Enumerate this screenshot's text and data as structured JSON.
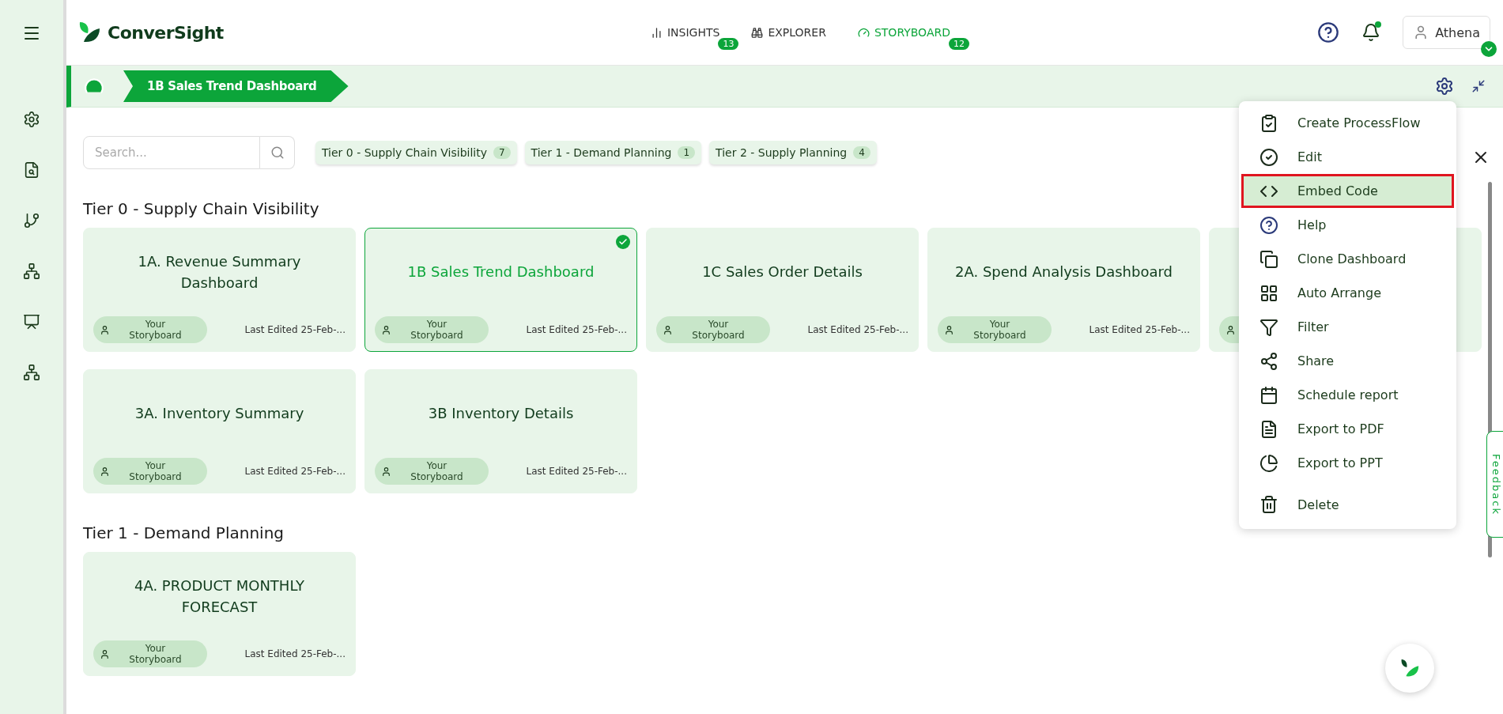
{
  "app": {
    "logo_text": "ConverSight"
  },
  "nav_tabs": [
    {
      "label": "INSIGHTS",
      "count": "13",
      "selected": false
    },
    {
      "label": "EXPLORER",
      "selected": false
    },
    {
      "label": "STORYBOARD",
      "count": "12",
      "selected": true
    }
  ],
  "notifications": {
    "unread": true
  },
  "user": {
    "name": "Athena"
  },
  "breadcrumb": {
    "title": "1B Sales Trend Dashboard"
  },
  "search": {
    "placeholder": "Search..."
  },
  "filter_chips": [
    {
      "label": "Tier 0 - Supply Chain Visibility",
      "count": "7"
    },
    {
      "label": "Tier 1 - Demand Planning",
      "count": "1"
    },
    {
      "label": "Tier 2 - Supply Planning",
      "count": "4"
    }
  ],
  "sections": [
    {
      "title": "Tier 0 - Supply Chain Visibility",
      "cards": [
        {
          "kind": "card",
          "title": "1A. Revenue Summary Dashboard",
          "selected": false,
          "owner": "Your Storyboard",
          "edited": "Last Edited 25-Feb-..."
        },
        {
          "kind": "card",
          "title": "1B Sales Trend Dashboard",
          "selected": true,
          "owner": "Your Storyboard",
          "edited": "Last Edited 25-Feb-..."
        },
        {
          "kind": "card",
          "title": "1C Sales Order Details",
          "selected": false,
          "owner": "Your Storyboard",
          "edited": "Last Edited 25-Feb-..."
        },
        {
          "kind": "card",
          "title": "2A. Spend Analysis Dashboard",
          "selected": false,
          "owner": "Your Storyboard",
          "edited": "Last Edited 25-Feb-..."
        },
        {
          "kind": "covered",
          "selected": false
        },
        {
          "kind": "card",
          "title": "3A. Inventory Summary",
          "selected": false,
          "owner": "Your Storyboard",
          "edited": "Last Edited 25-Feb-..."
        },
        {
          "kind": "card",
          "title": "3B Inventory Details",
          "selected": false,
          "owner": "Your Storyboard",
          "edited": "Last Edited 25-Feb-..."
        }
      ]
    },
    {
      "title": "Tier 1 - Demand Planning",
      "cards": [
        {
          "kind": "card",
          "title": "4A. PRODUCT MONTHLY FORECAST",
          "selected": false,
          "owner": "Your Storyboard",
          "edited": "Last Edited 25-Feb-..."
        }
      ]
    }
  ],
  "menu": {
    "items": [
      {
        "label": "Create ProcessFlow",
        "selected": false,
        "separated": false
      },
      {
        "label": "Edit",
        "selected": false,
        "separated": false
      },
      {
        "label": "Embed Code",
        "selected": true,
        "separated": false
      },
      {
        "label": "Help",
        "selected": false,
        "separated": false
      },
      {
        "label": "Clone Dashboard",
        "selected": false,
        "separated": false
      },
      {
        "label": "Auto Arrange",
        "selected": false,
        "separated": false
      },
      {
        "label": "Filter",
        "selected": false,
        "separated": false
      },
      {
        "label": "Share",
        "selected": false,
        "separated": false
      },
      {
        "label": "Schedule report",
        "selected": false,
        "separated": false
      },
      {
        "label": "Export to PDF",
        "selected": false,
        "separated": false
      },
      {
        "label": "Export to PPT",
        "selected": false,
        "separated": false
      },
      {
        "label": "Delete",
        "selected": false,
        "separated": true
      }
    ]
  },
  "feedback": {
    "label": "Feedback"
  }
}
